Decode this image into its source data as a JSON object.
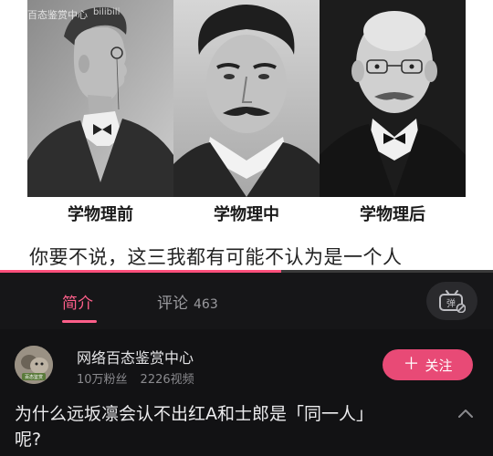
{
  "video": {
    "watermark": "百态鉴赏中心",
    "watermark_logo": "bilibili",
    "captions": [
      "学物理前",
      "学物理中",
      "学物理后"
    ],
    "subtitle": "你要不说，这三我都有可能不认为是一个人",
    "progress_fraction": 0.57
  },
  "tabs": [
    {
      "label": "简介",
      "active": true
    },
    {
      "label": "评论",
      "count": "463",
      "active": false
    }
  ],
  "danmaku_button": {
    "icon": "danmaku-toggle-icon",
    "glyph": "弹"
  },
  "uploader": {
    "name": "网络百态鉴赏中心",
    "followers": "10万粉丝",
    "videos": "2226视频",
    "avatar_text": "百态鉴赏"
  },
  "follow_button": {
    "label": "关注",
    "icon": "plus-icon"
  },
  "title": {
    "line1": "为什么远坂凛会认不出红A和士郎是「同一人」",
    "line2": "呢?"
  },
  "colors": {
    "accent": "#ff5f8a",
    "follow_bg": "#e84a76",
    "background": "#121214"
  }
}
